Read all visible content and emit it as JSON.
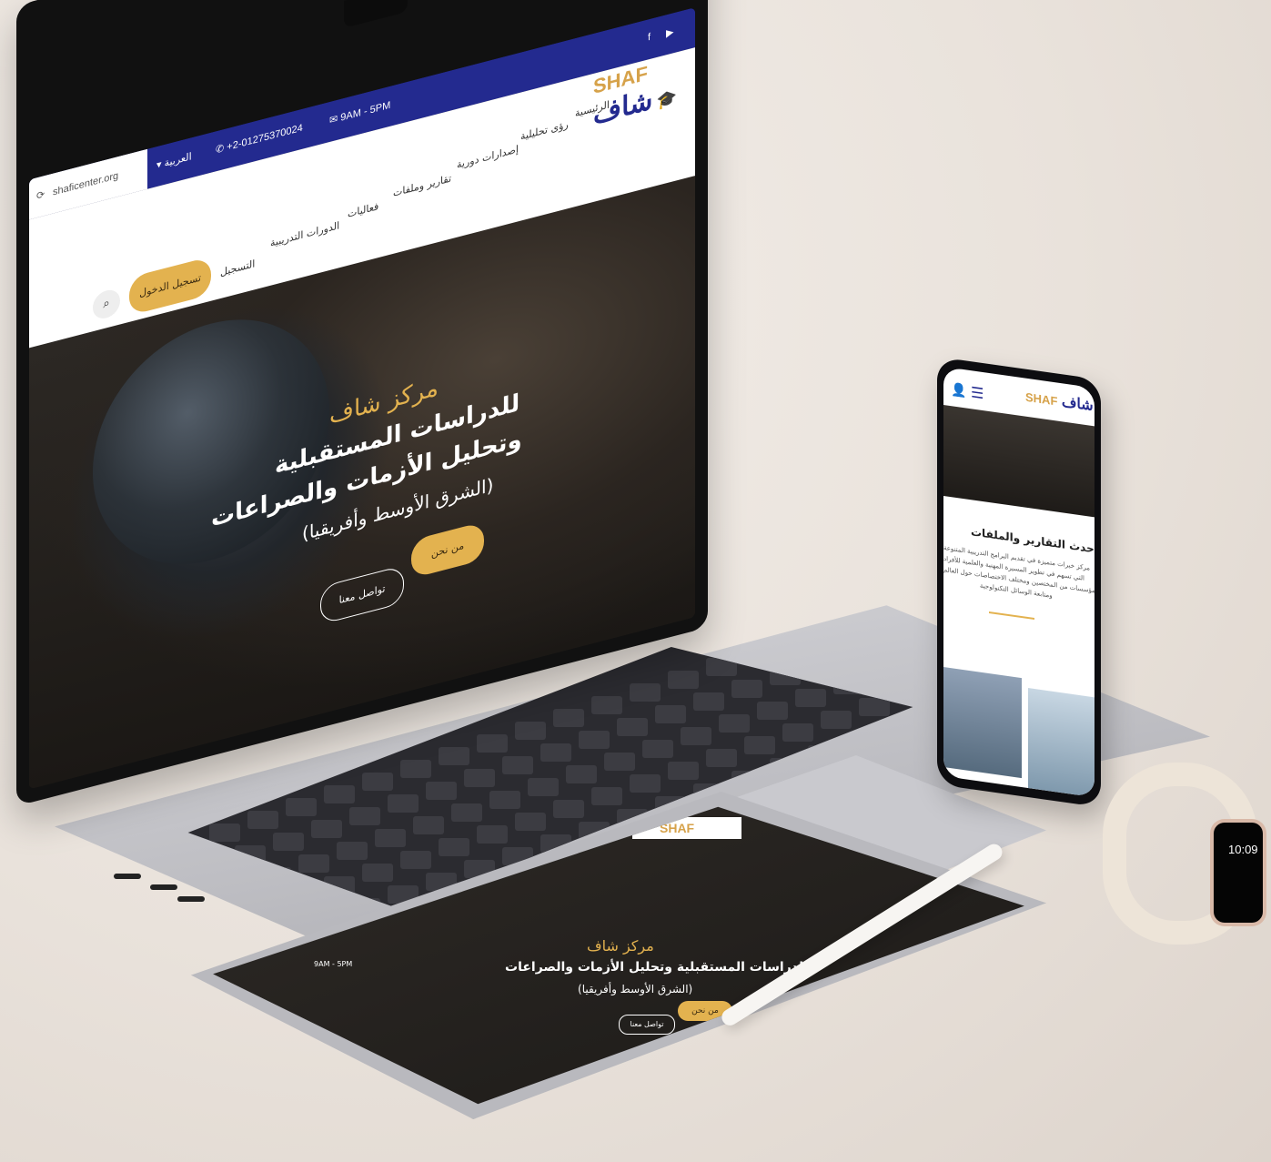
{
  "laptop": {
    "url": "shaficenter.org",
    "phone": "+2-01275370024",
    "hours": "9AM - 5PM",
    "language": "العربية",
    "logo_en": "SHAF",
    "logo_ar": "شاف",
    "nav": [
      "الرئيسية",
      "رؤى تحليلية",
      "إصدارات دورية",
      "تقارير وملفات",
      "فعاليات",
      "الدورات التدريبية"
    ],
    "register_link": "التسجيل",
    "login_button": "تسجيل الدخول",
    "hero": {
      "line1": "مركز شاف",
      "line2": "للدراسات المستقبلية",
      "line3": "وتحليل الأزمات والصراعات",
      "line4": "(الشرق الأوسط وأفريقيا)",
      "btn_about": "من نحن",
      "btn_contact": "تواصل معنا"
    }
  },
  "phone": {
    "logo_en": "SHAF",
    "logo_ar": "شاف",
    "section_title": "أحدث التقارير والملفات",
    "section_body": [
      "مركز خبرات متميزة في تقديم البرامج التدريبية المتنوعة",
      "التي تسهم في تطوير المسيرة المهنية والعلمية للأفراد",
      "والمؤسسات من المختصين ومختلف الاختصاصات حول العالم",
      "ومتابعة الوسائل التكنولوجية"
    ]
  },
  "watch": {
    "time": "10:09"
  },
  "tablet": {
    "logo_en": "SHAF",
    "hero_line1": "مركز شاف",
    "hero_line2": "للدراسات المستقبلية وتحليل الأزمات والصراعات",
    "hero_line3": "(الشرق الأوسط وأفريقيا)",
    "btn_about": "من نحن",
    "btn_contact": "تواصل معنا",
    "hours": "9AM - 5PM"
  },
  "colors": {
    "brand_blue": "#232a8f",
    "brand_gold": "#e3b24f"
  }
}
